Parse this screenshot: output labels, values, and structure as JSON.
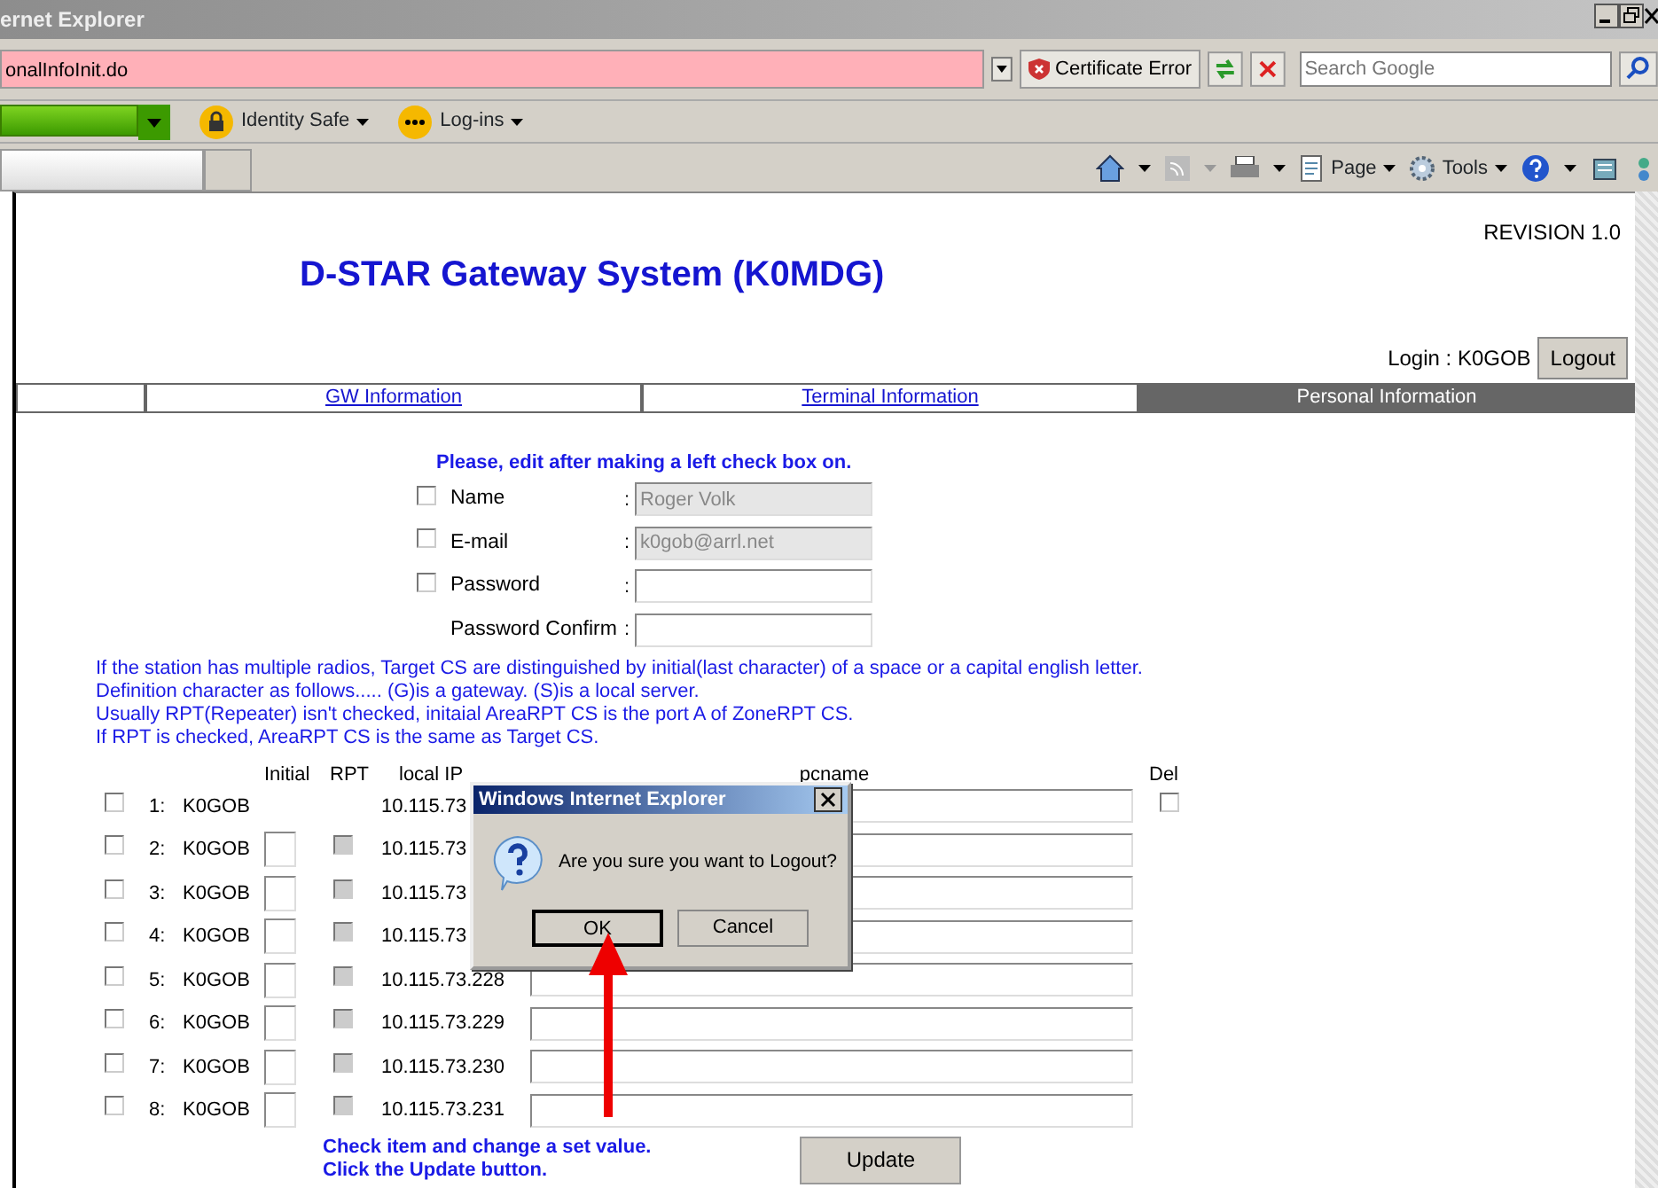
{
  "browser": {
    "title": "ernet Explorer",
    "address": "onalInfoInit.do",
    "certificate_error": "Certificate Error",
    "search_placeholder": "Search Google",
    "toolbar": [
      {
        "label": "Identity Safe"
      },
      {
        "label": "Log-ins"
      }
    ],
    "command_bar": [
      {
        "label": "Page"
      },
      {
        "label": "Tools"
      }
    ]
  },
  "page": {
    "revision": "REVISION 1.0",
    "title": "D-STAR Gateway System (K0MDG)",
    "login_label": "Login : K0GOB",
    "logout": "Logout",
    "nav": [
      {
        "label": "GW Information",
        "selected": false
      },
      {
        "label": "Terminal Information",
        "selected": false
      },
      {
        "label": "Personal Information",
        "selected": true
      }
    ],
    "form": {
      "heading": "Please, edit after making a left check box on.",
      "fields": [
        {
          "kind": "checkable",
          "label": "Name",
          "separator": ":",
          "checked": false,
          "value": "Roger Volk",
          "disabled": true
        },
        {
          "kind": "checkable",
          "label": "E-mail",
          "separator": ":",
          "checked": false,
          "value": "k0gob@arrl.net",
          "disabled": true
        },
        {
          "kind": "checkable",
          "label": "Password",
          "separator": ":",
          "checked": false,
          "disabled": false
        },
        {
          "kind": "plain",
          "label": "Password Confirm",
          "separator": ":",
          "disabled": false
        }
      ]
    },
    "notes": [
      "If the station has multiple radios, Target CS are distinguished by initial(last character) of a space or a capital english letter.",
      "Definition character as follows..... (G)is a gateway. (S)is a local server.",
      "Usually RPT(Repeater) isn't checked, initaial AreaRPT CS is the port A of ZoneRPT CS.",
      "If RPT is checked, AreaRPT CS is the same as Target CS."
    ],
    "table": {
      "columns": [
        "Initial",
        "RPT",
        "local IP",
        "pcname",
        "Del"
      ],
      "rows": [
        {
          "kind": "gateway",
          "checked": false,
          "number": "1:",
          "callsign": "K0GOB",
          "ip": "10.115.73",
          "del_checked": false
        },
        {
          "kind": "terminal",
          "checked": false,
          "number": "2:",
          "callsign": "K0GOB",
          "rpt_checked": false,
          "ip": "10.115.73"
        },
        {
          "kind": "terminal",
          "checked": false,
          "number": "3:",
          "callsign": "K0GOB",
          "rpt_checked": false,
          "ip": "10.115.73"
        },
        {
          "kind": "terminal",
          "checked": false,
          "number": "4:",
          "callsign": "K0GOB",
          "rpt_checked": false,
          "ip": "10.115.73"
        },
        {
          "kind": "terminal",
          "checked": false,
          "number": "5:",
          "callsign": "K0GOB",
          "rpt_checked": false,
          "ip": "10.115.73.228"
        },
        {
          "kind": "terminal",
          "checked": false,
          "number": "6:",
          "callsign": "K0GOB",
          "rpt_checked": false,
          "ip": "10.115.73.229"
        },
        {
          "kind": "terminal",
          "checked": false,
          "number": "7:",
          "callsign": "K0GOB",
          "rpt_checked": false,
          "ip": "10.115.73.230"
        },
        {
          "kind": "terminal",
          "checked": false,
          "number": "8:",
          "callsign": "K0GOB",
          "rpt_checked": false,
          "ip": "10.115.73.231"
        }
      ]
    },
    "footer_notes": [
      "Check item and change a set value.",
      "Click the Update button."
    ],
    "update": "Update"
  },
  "dialog": {
    "title": "Windows Internet Explorer",
    "message": "Are you sure you want to Logout?",
    "buttons": [
      {
        "label": "OK",
        "focused": true
      },
      {
        "label": "Cancel",
        "focused": false
      }
    ]
  }
}
